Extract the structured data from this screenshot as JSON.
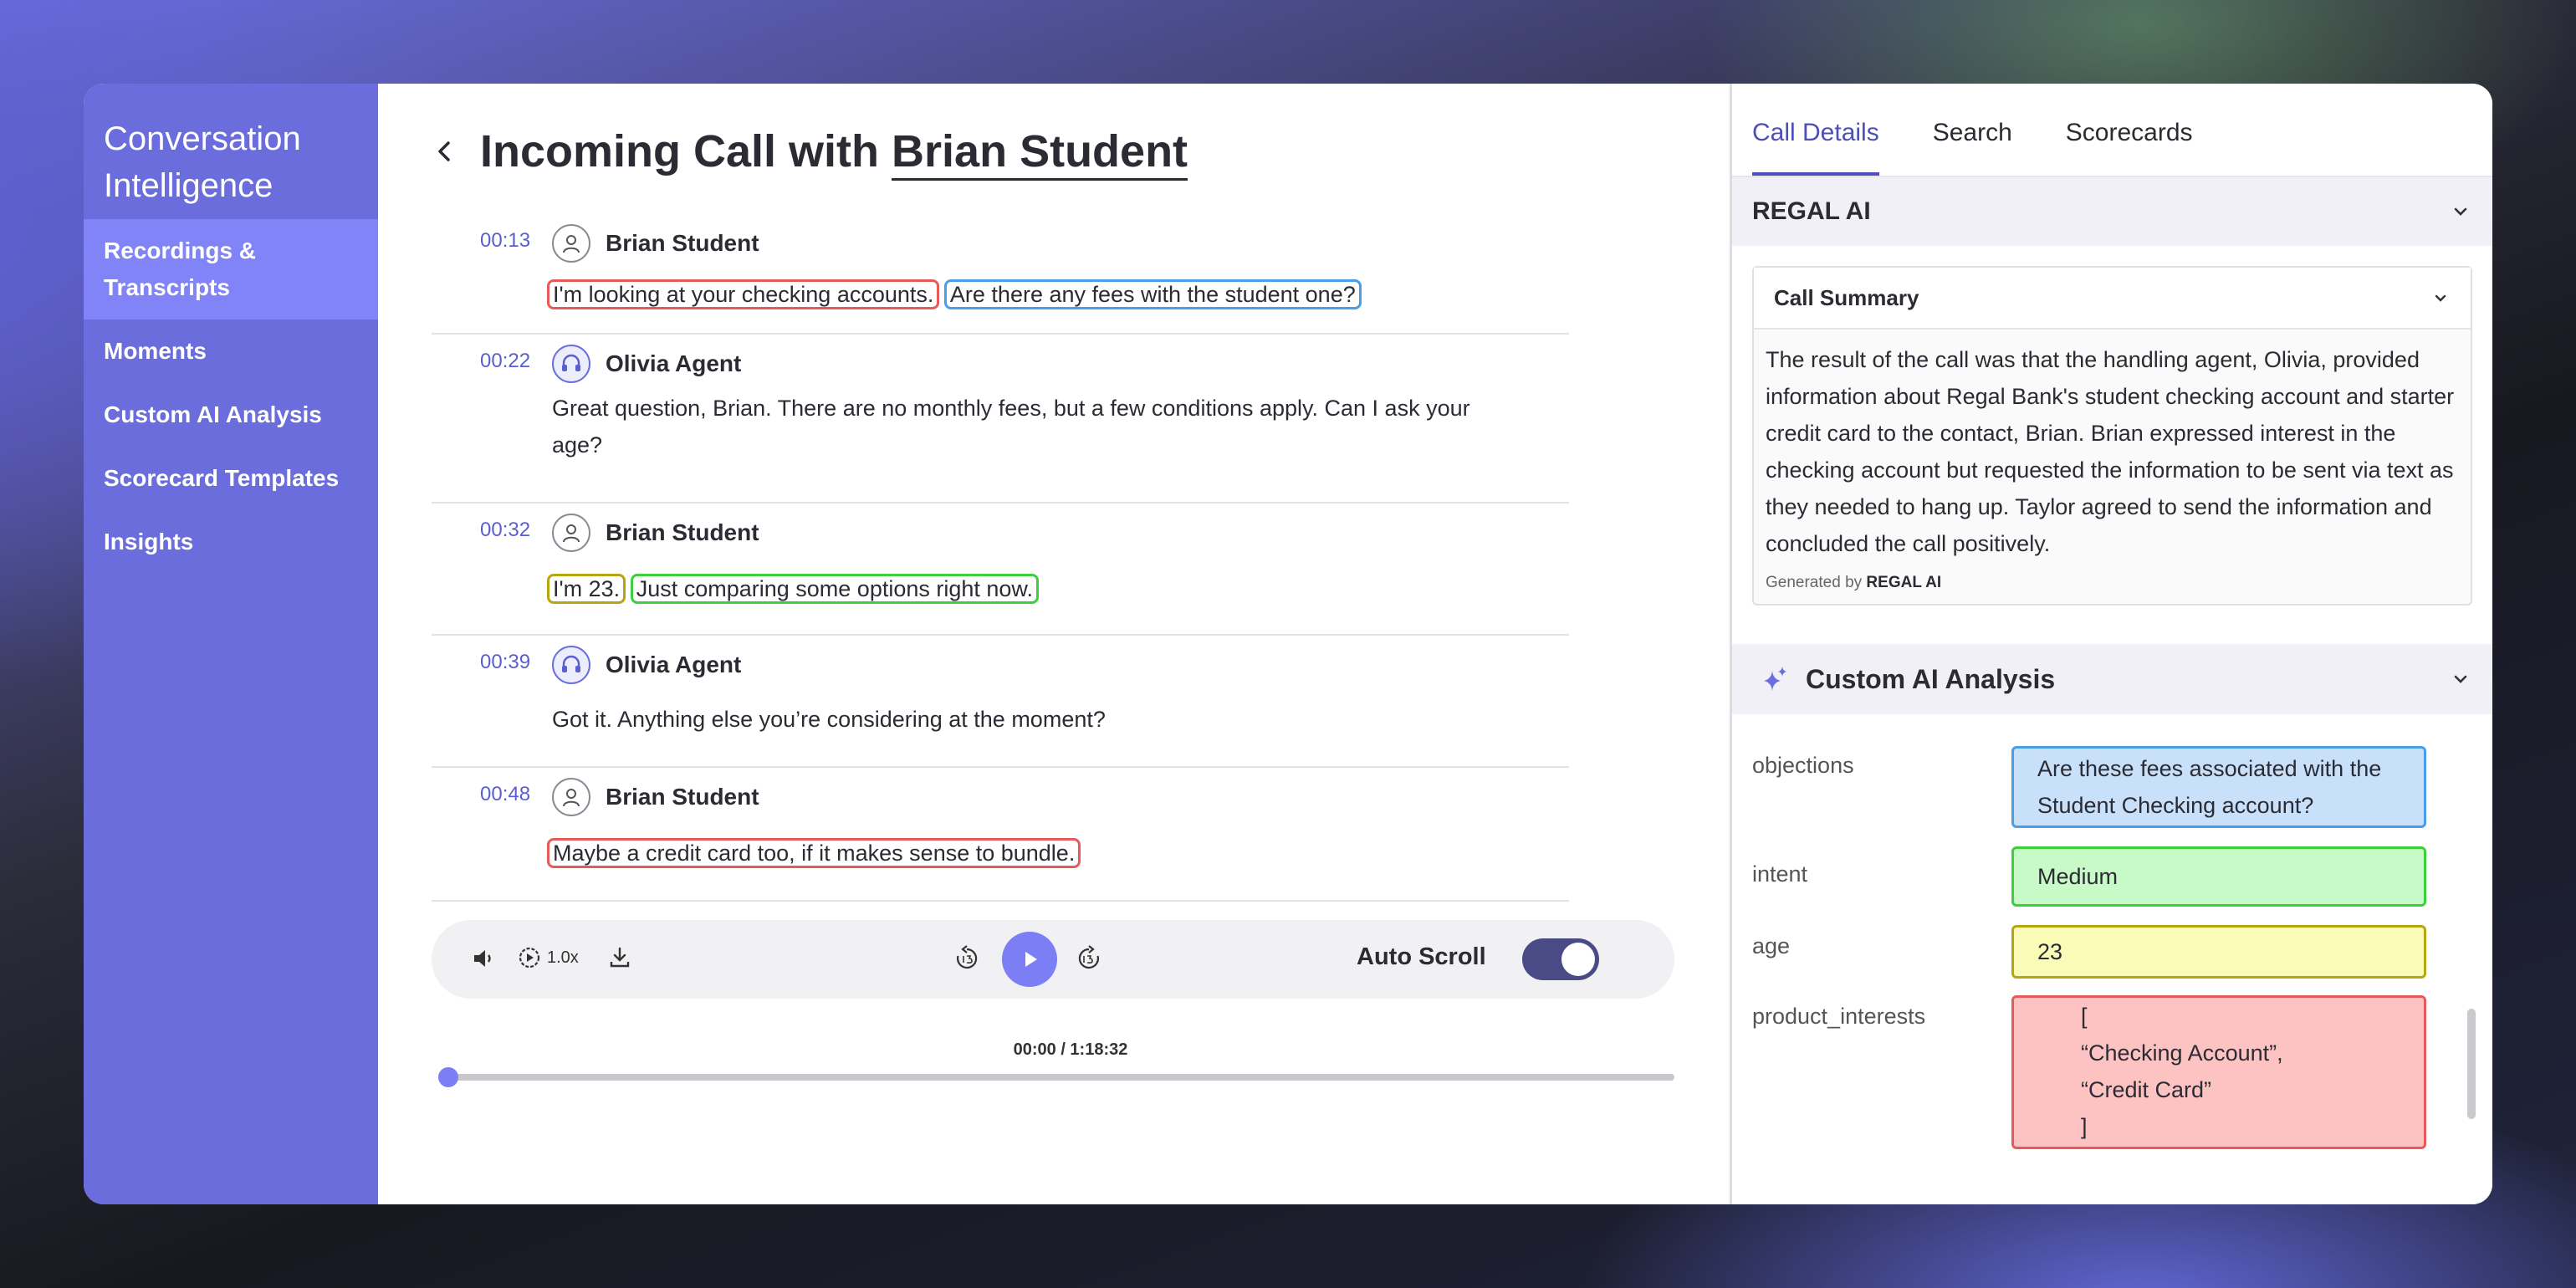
{
  "sidebar": {
    "brand": "Conversation Intelligence",
    "items": [
      {
        "label": "Recordings & Transcripts",
        "active": true
      },
      {
        "label": "Moments"
      },
      {
        "label": "Custom AI Analysis"
      },
      {
        "label": "Scorecard Templates"
      },
      {
        "label": "Insights"
      }
    ]
  },
  "header": {
    "title_prefix": "Incoming Call with",
    "contact_name": "Brian Student"
  },
  "transcript": [
    {
      "time": "00:13",
      "speaker": "Brian Student",
      "role": "customer",
      "segments": [
        {
          "text": "I'm looking at your checking accounts.",
          "highlight": "red"
        },
        {
          "text": "Are there any fees with the student one?",
          "highlight": "blue"
        }
      ]
    },
    {
      "time": "00:22",
      "speaker": "Olivia Agent",
      "role": "agent",
      "segments": [
        {
          "text": "Great question, Brian. There are no monthly fees, but a few conditions apply. Can I ask your age?",
          "highlight": null
        }
      ]
    },
    {
      "time": "00:32",
      "speaker": "Brian Student",
      "role": "customer",
      "segments": [
        {
          "text": "I'm 23.",
          "highlight": "olive"
        },
        {
          "text": "Just comparing some options right now.",
          "highlight": "green"
        }
      ]
    },
    {
      "time": "00:39",
      "speaker": "Olivia Agent",
      "role": "agent",
      "segments": [
        {
          "text": "Got it. Anything else you’re considering at the moment?",
          "highlight": null
        }
      ]
    },
    {
      "time": "00:48",
      "speaker": "Brian Student",
      "role": "customer",
      "segments": [
        {
          "text": "Maybe a credit card too, if it makes sense to bundle.",
          "highlight": "red"
        }
      ]
    }
  ],
  "player": {
    "speed": "1.0x",
    "auto_scroll_label": "Auto Scroll",
    "auto_scroll_on": true,
    "time_readout": "00:00 / 1:18:32",
    "progress": 0.0,
    "accent": "#7b7ef4"
  },
  "right_panel": {
    "tabs": [
      {
        "label": "Call Details",
        "active": true
      },
      {
        "label": "Search"
      },
      {
        "label": "Scorecards"
      }
    ],
    "regal_section": {
      "title": "REGAL AI",
      "summary_title": "Call Summary",
      "summary_text": "The result of the call was that the handling agent, Olivia, provided information about Regal Bank's student checking account and starter credit card to the contact, Brian. Brian expressed interest in the checking account but requested the information to be sent via text as they needed to hang up. Taylor agreed to send the information and concluded the call positively.",
      "generated_by": "Generated by",
      "generated_brand": "REGAL AI"
    },
    "custom_ai": {
      "title": "Custom AI Analysis",
      "fields": [
        {
          "key": "objections",
          "value": "Are these fees associated with the Student Checking account?",
          "color": "blue"
        },
        {
          "key": "intent",
          "value": "Medium",
          "color": "green"
        },
        {
          "key": "age",
          "value": "23",
          "color": "yellow"
        },
        {
          "key": "product_interests",
          "lines": [
            "[",
            "“Checking Account”,",
            "“Credit Card”",
            "]"
          ],
          "color": "red"
        }
      ]
    }
  }
}
